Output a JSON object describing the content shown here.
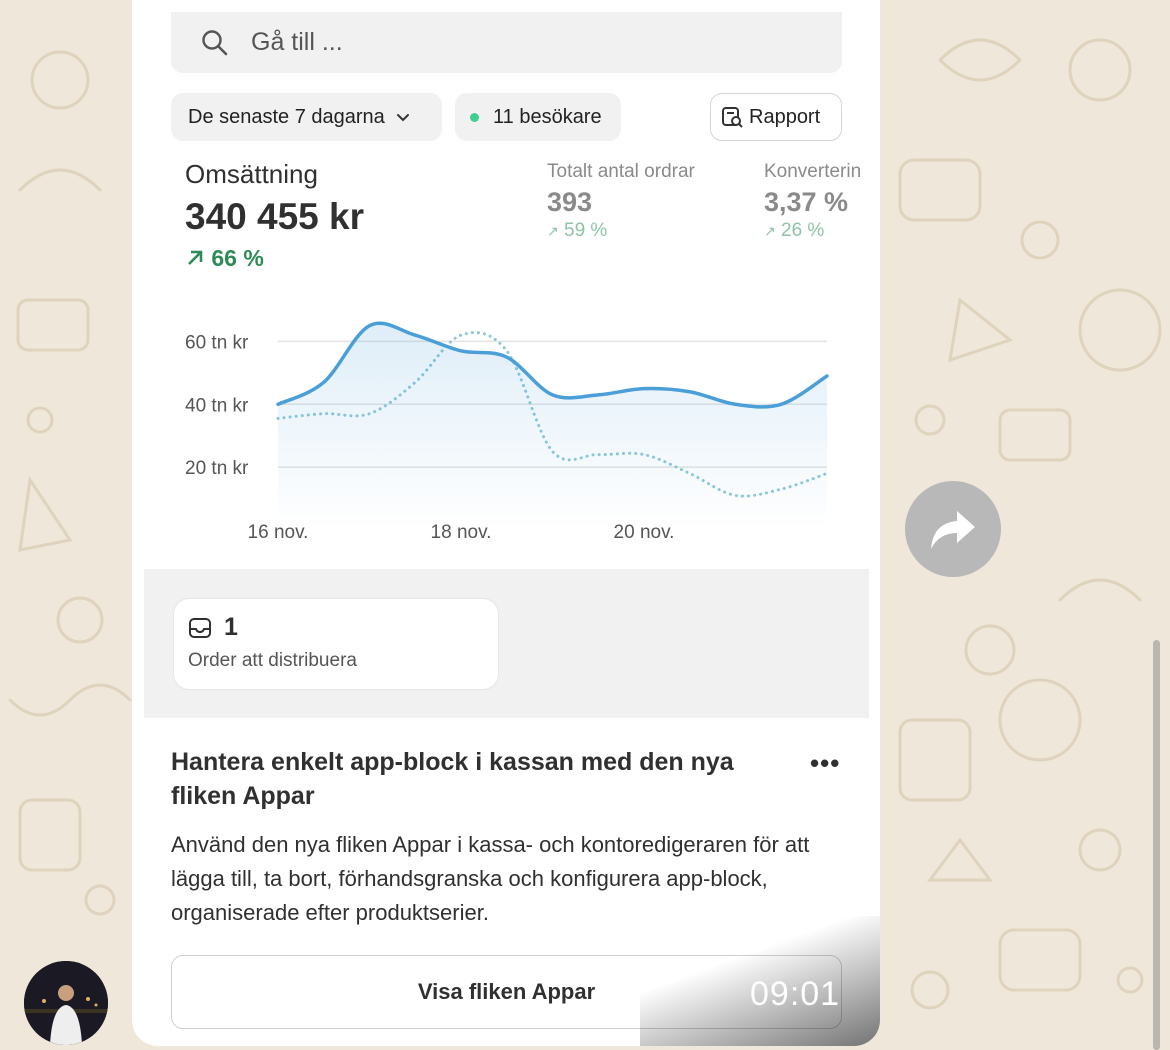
{
  "search": {
    "placeholder": "Gå till ...",
    "icon": "search-icon"
  },
  "filters": {
    "range_label": "De senaste 7 dagarna",
    "visitors_label": "11 besökare",
    "report_label": "Rapport"
  },
  "metrics": {
    "revenue": {
      "label": "Omsättning",
      "value": "340 455 kr",
      "change": "66 %"
    },
    "orders": {
      "label": "Totalt antal ordrar",
      "value": "393",
      "change": "59 %"
    },
    "conversion": {
      "label": "Konverterin",
      "value": "3,37 %",
      "change": "26 %"
    }
  },
  "chart_data": {
    "type": "line",
    "y_tick_labels": [
      "60 tn kr",
      "40 tn kr",
      "20 tn kr"
    ],
    "y_ticks": [
      60000,
      40000,
      20000
    ],
    "x_tick_labels": [
      "16 nov.",
      "18 nov.",
      "20 nov."
    ],
    "x_ticks": [
      16,
      18,
      20
    ],
    "ylim": [
      0,
      70000
    ],
    "xlim": [
      16,
      22
    ],
    "grid": true,
    "series": [
      {
        "style": "solid",
        "color": "#4a9fd8",
        "x": [
          16,
          16.5,
          17,
          17.5,
          18,
          18.5,
          19,
          19.5,
          20,
          20.5,
          21,
          21.5,
          22
        ],
        "y": [
          40000,
          47000,
          65000,
          62000,
          57000,
          55000,
          43000,
          43000,
          45000,
          44000,
          40000,
          40000,
          49000
        ]
      },
      {
        "style": "dotted",
        "color": "#8cc8d8",
        "x": [
          16,
          16.5,
          17,
          17.5,
          18,
          18.5,
          19,
          19.5,
          20,
          20.5,
          21,
          21.5,
          22
        ],
        "y": [
          35500,
          37000,
          37000,
          47000,
          62000,
          57000,
          25000,
          24000,
          24000,
          18000,
          11000,
          13000,
          18000
        ]
      }
    ]
  },
  "fulfillment": {
    "count": "1",
    "label": "Order att distribuera"
  },
  "news": {
    "title": "Hantera enkelt app-block i kassan med den nya fliken Appar",
    "body": "Använd den nya fliken Appar i kassa- och kontoredigeraren för att lägga till, ta bort, förhandsgranska och konfigurera app-block, organiserade efter produktserier.",
    "cta": "Visa fliken Appar",
    "menu": "•••"
  },
  "message": {
    "time": "09:01"
  },
  "colors": {
    "accent_green": "#2e8b57",
    "chart_blue": "#4a9fd8",
    "wallpaper": "#efe7d9"
  }
}
